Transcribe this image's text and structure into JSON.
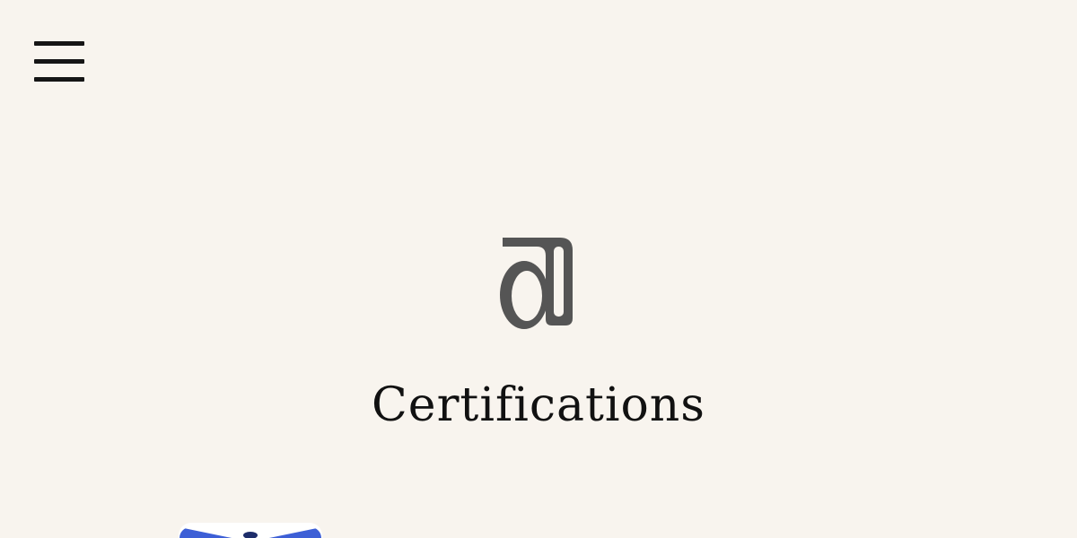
{
  "header": {
    "menu_icon": "hamburger-menu-icon"
  },
  "hero": {
    "logo_icon": "at-sign-logo-icon",
    "title": "Certifications"
  },
  "preview": {
    "badge_icon": "certification-badge-icon",
    "accent": "#3d5fd6"
  },
  "colors": {
    "background": "#f8f4ee",
    "text": "#111111",
    "logo": "#555555"
  }
}
